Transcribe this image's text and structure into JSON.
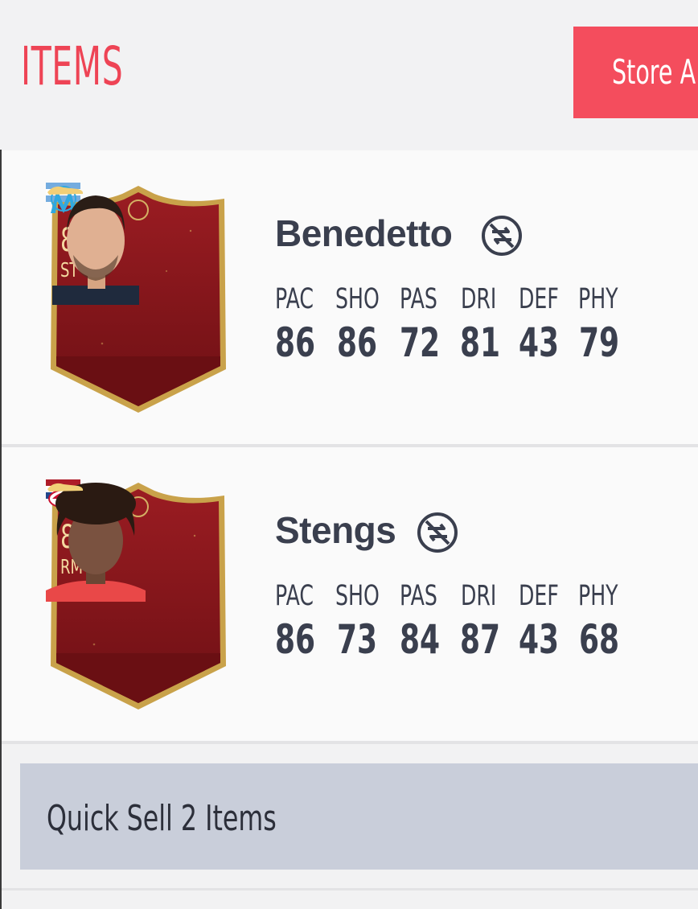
{
  "header": {
    "title": "ITEMS",
    "store_button": "Store A"
  },
  "players": [
    {
      "name": "Benedetto",
      "rating": "84",
      "position": "ST",
      "nation_flag": "argentina-flag",
      "club_badge": "marseille-badge",
      "card_color": "#8f1a1e",
      "untradeable": true,
      "stats": [
        {
          "label": "PAC",
          "value": "86"
        },
        {
          "label": "SHO",
          "value": "86"
        },
        {
          "label": "PAS",
          "value": "72"
        },
        {
          "label": "DRI",
          "value": "81"
        },
        {
          "label": "DEF",
          "value": "43"
        },
        {
          "label": "PHY",
          "value": "79"
        }
      ]
    },
    {
      "name": "Stengs",
      "rating": "84",
      "position": "RM",
      "nation_flag": "netherlands-flag",
      "club_badge": "az-badge",
      "card_color": "#8f1a1e",
      "untradeable": true,
      "stats": [
        {
          "label": "PAC",
          "value": "86"
        },
        {
          "label": "SHO",
          "value": "73"
        },
        {
          "label": "PAS",
          "value": "84"
        },
        {
          "label": "DRI",
          "value": "87"
        },
        {
          "label": "DEF",
          "value": "43"
        },
        {
          "label": "PHY",
          "value": "68"
        }
      ]
    }
  ],
  "quick_sell": {
    "label": "Quick Sell 2 Items"
  },
  "colors": {
    "accent": "#f44d5d",
    "card_gold": "#c9a24a",
    "text_dark": "#3a3f4e"
  }
}
